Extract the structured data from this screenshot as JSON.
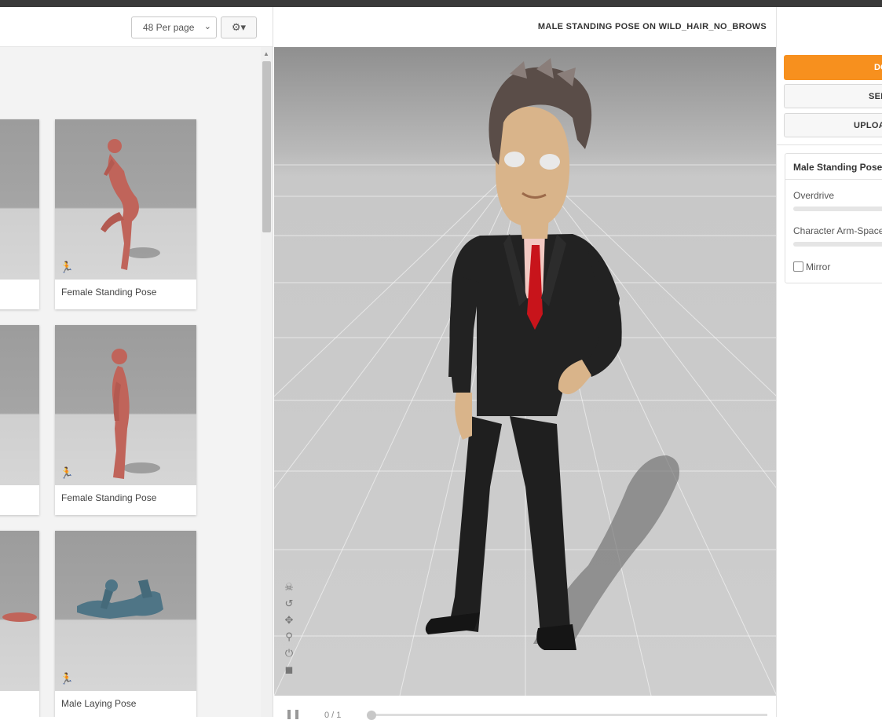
{
  "toolbar": {
    "per_page": "48 Per page",
    "per_page_chevron": "⌄",
    "settings_icon": "⚙▾"
  },
  "poses": [
    {
      "label": "Female Standing Pose"
    },
    {
      "label": "Female Standing Pose"
    },
    {
      "label": "Male Laying Pose"
    }
  ],
  "viewer": {
    "title": "MALE STANDING POSE ON WILD_HAIR_NO_BROWS",
    "frame_counter": "0 / 1",
    "tools": [
      "☠",
      "↺",
      "✥",
      "⚲",
      "⏻",
      "◼"
    ],
    "pause_icon": "❚❚"
  },
  "actions": {
    "primary_label": "DO",
    "send_label": "SEN",
    "upload_label": "UPLOA"
  },
  "pose_settings": {
    "title": "Male Standing Pose",
    "overdrive_label": "Overdrive",
    "arm_space_label": "Character Arm-Space",
    "mirror_label": "Mirror"
  },
  "icons": {
    "run": "🏃"
  },
  "colors": {
    "accent": "#f7901e",
    "mannequin_red": "#c0645a",
    "mannequin_blue": "#4f7586",
    "suit": "#1f1f1f",
    "tie": "#c8141b"
  }
}
